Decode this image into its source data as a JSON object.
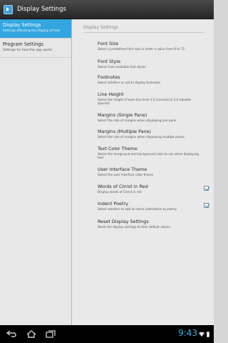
{
  "app": {
    "title": "Display Settings",
    "icon": "app-icon"
  },
  "headers": [
    {
      "title": "Display Settings",
      "summary": "Settings affecting the display of text",
      "selected": true
    },
    {
      "title": "Program Settings",
      "summary": "Settings for how this app works",
      "selected": false
    }
  ],
  "section": {
    "title": "Display Settings"
  },
  "prefs": [
    {
      "title": "Font Size",
      "summary": "Select a predefined font size or enter a value from 8 to 72"
    },
    {
      "title": "Font Style",
      "summary": "Select from available font styles"
    },
    {
      "title": "Footnotes",
      "summary": "Select whether or not to display footnotes"
    },
    {
      "title": "Line Height",
      "summary": "Select the height of each line from 1.0 (normal) to 2.0 (double-spaced)"
    },
    {
      "title": "Margins (Single Pane)",
      "summary": "Select the size of margins when displaying one pane"
    },
    {
      "title": "Margins (Multiple Pane)",
      "summary": "Select the size of margins when displaying multiple panes"
    },
    {
      "title": "Text Color Theme",
      "summary": "Select the foreground and background color to use when displaying text"
    },
    {
      "title": "User Interface Theme",
      "summary": "Select the user interface color theme"
    },
    {
      "title": "Words of Christ in Red",
      "summary": "Display words of Christ in red",
      "checked": true
    },
    {
      "title": "Indent Poetry",
      "summary": "Select whether to add an extra indentation to poetry",
      "checked": true
    },
    {
      "title": "Reset Display Settings",
      "summary": "Reset the display settings to their default values"
    }
  ],
  "status_bar": {
    "time": "9:43",
    "accent": "#33b5e5"
  }
}
